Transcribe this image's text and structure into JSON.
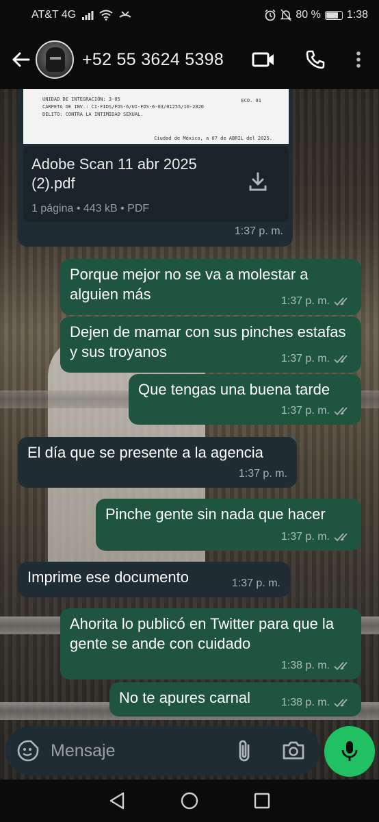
{
  "status_bar": {
    "carrier": "AT&T 4G",
    "battery": "80 %",
    "battery_level": 0.8,
    "time": "1:38"
  },
  "header": {
    "contact": "+52 55 3624 5398",
    "icons": [
      "back-arrow-icon",
      "video-call-icon",
      "voice-call-icon",
      "more-vert-icon"
    ]
  },
  "document_message": {
    "preview_lines": [
      "UNIDAD DE INTEGRACIÓN: 3-05",
      "CARPETA DE INV.: CI-FIDS/FDS-6/UI-FDS-6-03/01255/10-2020",
      "DELITO: CONTRA LA INTIMIDAD SEXUAL."
    ],
    "preview_right": "ECO. 91",
    "preview_footer": "Ciudad de México, a 07 de ABRIL del 2025.",
    "filename": "Adobe Scan 11 abr 2025 (2).pdf",
    "info": "1 página • 443 kB • PDF",
    "time": "1:37 p. m."
  },
  "messages": [
    {
      "direction": "out",
      "text": "Porque mejor no se va a molestar a alguien más",
      "time": "1:37 p. m."
    },
    {
      "direction": "out",
      "text": "Dejen de mamar con sus pinches estafas y sus troyanos",
      "time": "1:37 p. m."
    },
    {
      "direction": "out",
      "text": "Que tengas una buena tarde",
      "time": "1:37 p. m."
    },
    {
      "direction": "in",
      "text": "El día que se presente a la agencia",
      "time": "1:37 p. m."
    },
    {
      "direction": "out",
      "text": "Pinche gente sin nada que hacer",
      "time": "1:37 p. m."
    },
    {
      "direction": "in",
      "text": "Imprime ese documento",
      "time": "1:37 p. m."
    },
    {
      "direction": "out",
      "text": "Ahorita lo publicó en Twitter para que la gente se ande con cuidado",
      "time": "1:38 p. m."
    },
    {
      "direction": "out",
      "text": "No te apures carnal",
      "time": "1:38 p. m."
    }
  ],
  "input": {
    "placeholder": "Mensaje"
  },
  "colors": {
    "outgoing_bubble": "#1f5440",
    "incoming_bubble": "#1f2c34",
    "mic_button": "#21c063",
    "read_ticks": "#a7b3b0"
  }
}
